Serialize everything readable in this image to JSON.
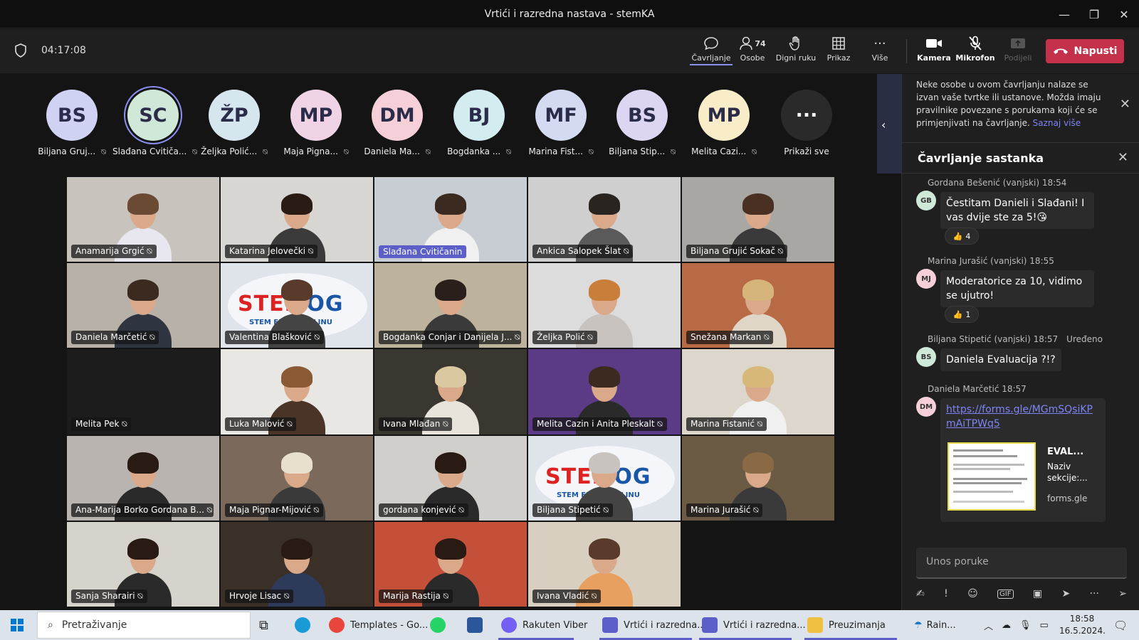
{
  "window": {
    "title": "Vrtići i razredna nastava - stemKA",
    "min": "—",
    "max": "❐",
    "close": "✕"
  },
  "meeting": {
    "timer": "04:17:08",
    "toolbar": {
      "chat": "Čavrljanje",
      "people": "Osobe",
      "people_count": "74",
      "raise": "Digni ruku",
      "view": "Prikaz",
      "more": "Više",
      "camera": "Kamera",
      "mic": "Mikrofon",
      "share": "Podijeli",
      "leave": "Napusti"
    }
  },
  "avatars": [
    {
      "initials": "BS",
      "name": "Biljana Gruj...",
      "color": "#cfd2f3"
    },
    {
      "initials": "SC",
      "name": "Slađana Cvitiča...",
      "color": "#cfe8d8"
    },
    {
      "initials": "ŽP",
      "name": "Željka Polić...",
      "color": "#d6e6ef"
    },
    {
      "initials": "MP",
      "name": "Maja Pigna...",
      "color": "#f1d3e6"
    },
    {
      "initials": "DM",
      "name": "Daniela Ma...",
      "color": "#f5d0d8"
    },
    {
      "initials": "BJ",
      "name": "Bogdanka ...",
      "color": "#d3ecef"
    },
    {
      "initials": "MF",
      "name": "Marina Fist...",
      "color": "#d3daf2"
    },
    {
      "initials": "BS",
      "name": "Biljana Stip...",
      "color": "#dcd6f3"
    },
    {
      "initials": "MP",
      "name": "Melita Cazi...",
      "color": "#f8ecc9"
    },
    {
      "initials": "···",
      "name": "Prikaži sve",
      "color": "#2a2a2a"
    }
  ],
  "tiles": [
    {
      "name": "Anamarija Grgić",
      "bg": "#c9c3bd",
      "shirt": "#e8e6ee",
      "hair": "#6b4a34"
    },
    {
      "name": "Katarina Jelovečki",
      "bg": "#d8d6d2",
      "shirt": "#3b3b3b",
      "hair": "#2a1c14"
    },
    {
      "name": "Slađana Cvitičanin",
      "bg": "#c7cdd2",
      "shirt": "#f0f0f0",
      "hair": "#3a2a20",
      "highlight": true
    },
    {
      "name": "Ankica Salopek Šlat",
      "bg": "#cfcfcf",
      "shirt": "#5a5a5a",
      "hair": "#2a2420"
    },
    {
      "name": "Biljana  Grujić Sokač",
      "bg": "#a9a7a4",
      "shirt": "#3a3a3a",
      "hair": "#4a3022"
    },
    {
      "name": "Daniela Marčetić",
      "bg": "#b7b1a8",
      "shirt": "#2e3440",
      "hair": "#3a2a20"
    },
    {
      "name": "Valentina Blašković",
      "bg": "#dfe3ea",
      "shirt": "#444",
      "hair": "#5a3a2a",
      "logo": true
    },
    {
      "name": "Bogdanka Conjar i Danijela J...",
      "bg": "#bdb39c",
      "shirt": "#3a3a3a",
      "hair": "#2a1f1a"
    },
    {
      "name": "Željka Polić",
      "bg": "#dcdcdc",
      "shirt": "#c9c3c0",
      "hair": "#c97f3a"
    },
    {
      "name": "Snežana Markan",
      "bg": "#b86a44",
      "shirt": "#e0d6c8",
      "hair": "#d6b57a"
    },
    {
      "name": "Melita Pek",
      "bg": "#1c1c1c",
      "empty": true
    },
    {
      "name": "Luka Malović",
      "bg": "#e9e7e4",
      "shirt": "#4a3428",
      "hair": "#8a5a34"
    },
    {
      "name": "Ivana Mlađan",
      "bg": "#3a3630",
      "shirt": "#e8e4dc",
      "hair": "#d9c8a0"
    },
    {
      "name": "Melita Cazin i Anita Pleskalt",
      "bg": "#5b3a86",
      "shirt": "#2a2a2a",
      "hair": "#3a2a20"
    },
    {
      "name": "Marina Fistanić",
      "bg": "#dcd6cc",
      "shirt": "#f0f0f0",
      "hair": "#d8b878"
    },
    {
      "name": "Ana-Marija Borko Gordana B...",
      "bg": "#b9b4b0",
      "shirt": "#2a2a2a",
      "hair": "#2a1a14"
    },
    {
      "name": "Maja Pignar-Mijović",
      "bg": "#7b6a5c",
      "shirt": "#3a3a3a",
      "hair": "#e8e0cc"
    },
    {
      "name": "gordana konjević",
      "bg": "#d0cfcb",
      "shirt": "#2a2a2a",
      "hair": "#2a1a14"
    },
    {
      "name": "Biljana Stipetić",
      "bg": "#dfe3ea",
      "shirt": "#444",
      "hair": "#c9c3c0",
      "logo": true
    },
    {
      "name": "Marina Jurašić",
      "bg": "#6b5a44",
      "shirt": "#3a3a3a",
      "hair": "#8a6a44"
    },
    {
      "name": "Sanja Sharairi",
      "bg": "#d6d2cc",
      "shirt": "#2a2a2a",
      "hair": "#2a1a14"
    },
    {
      "name": "Hrvoje Lisac",
      "bg": "#3a3028",
      "shirt": "#2e3a5a",
      "hair": "#2a1a14"
    },
    {
      "name": "Marija Rastija",
      "bg": "#c4503a",
      "shirt": "#2a2a2a",
      "hair": "#2a1a14"
    },
    {
      "name": "Ivana Vladić",
      "bg": "#d8cfc0",
      "shirt": "#e8a060",
      "hair": "#5a3a2a"
    }
  ],
  "logo": {
    "stem": "STEM",
    "og": "OG",
    "rad": "rad",
    "fest": "STEM FEST OGULINU"
  },
  "panel": {
    "notice": "Neke osobe u ovom čavrljanju nalaze se izvan vaše tvrtke ili ustanove. Možda imaju pravilnike povezane s porukama koji će se primjenjivati na čavrljanje.",
    "notice_link": "Saznaj više",
    "chat_title": "Čavrljanje sastanka",
    "messages": [
      {
        "initials": "GB",
        "meta": "Gordana Bešenić (vanjski)  18:54",
        "text": "Čestitam Danieli i Slađani! I vas dvije ste za 5!😘",
        "reaction": "👍",
        "reaction_count": "4",
        "color": "#cfe8d8"
      },
      {
        "initials": "MJ",
        "meta": "Marina Jurašić (vanjski)  18:55",
        "text": "Moderatorice za 10, vidimo se ujutro!",
        "reaction": "👍",
        "reaction_count": "1",
        "color": "#f5d0d8"
      },
      {
        "initials": "BS",
        "meta": "Biljana Stipetić (vanjski)  18:57",
        "edited": "Uređeno",
        "text": "Daniela Evaluacija ?!?",
        "color": "#cfe8d8"
      },
      {
        "initials": "DM",
        "meta": "Daniela Marčetić  18:57",
        "text": "https://forms.gle/MGmSQsiKPmAiTPWq5",
        "color": "#f5d0d8"
      }
    ],
    "preview": {
      "title": "EVAL...",
      "desc": "Naziv sekcije:...",
      "url": "forms.gle"
    },
    "compose_placeholder": "Unos poruke"
  },
  "taskbar": {
    "search": "Pretraživanje",
    "apps": [
      {
        "label": "Templates - Go...",
        "color": "#e8453c"
      },
      {
        "label": "Rakuten Viber",
        "color": "#7360f2"
      },
      {
        "label": "Vrtići i razredna...",
        "color": "#5b5fc7"
      },
      {
        "label": "Vrtići i razredna...",
        "color": "#5b5fc7"
      },
      {
        "label": "Preuzimanja",
        "color": "#f0c040"
      }
    ],
    "weather": "Rain...",
    "time": "18:58",
    "date": "16.5.2024."
  }
}
